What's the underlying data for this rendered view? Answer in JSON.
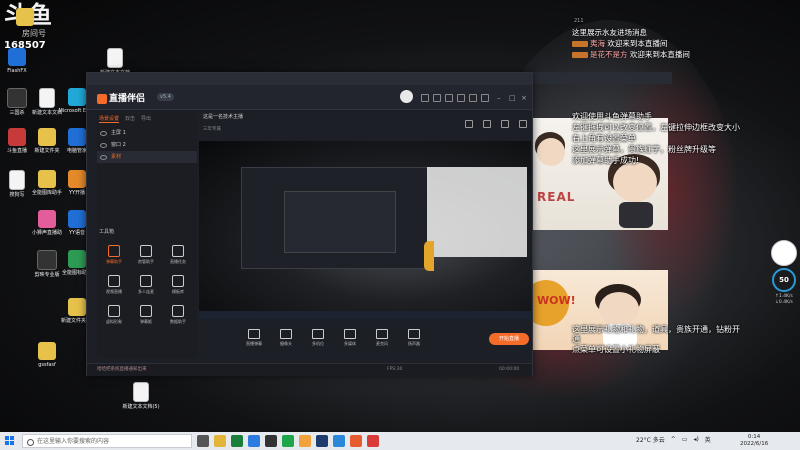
{
  "overlay": {
    "logo": "斗鱼",
    "room_label": "房间号",
    "room_number": "168507"
  },
  "desktop_icons": [
    {
      "label": "",
      "kind": "folder"
    },
    {
      "label": "新建文本文档",
      "kind": "doc"
    },
    {
      "label": "FlashFX",
      "kind": "blue"
    },
    {
      "label": "三国杀",
      "kind": "dark"
    },
    {
      "label": "新建文本文档",
      "kind": "doc"
    },
    {
      "label": "Microsoft Edge",
      "kind": "cyan"
    },
    {
      "label": "斗鱼直播",
      "kind": "red"
    },
    {
      "label": "新建文件夹",
      "kind": "folder"
    },
    {
      "label": "电脑管家",
      "kind": "blue"
    },
    {
      "label": "双环斗地主",
      "kind": "red"
    },
    {
      "label": "微信图片_2022022...",
      "kind": "doc"
    },
    {
      "label": "YY开播",
      "kind": "dark"
    },
    {
      "label": "搜狗写",
      "kind": "blue"
    },
    {
      "label": "全能图库助手",
      "kind": "folder"
    },
    {
      "label": "YY开播",
      "kind": "orange"
    },
    {
      "label": "小狮声直播助",
      "kind": "pink"
    },
    {
      "label": "YY语音",
      "kind": "blue"
    },
    {
      "label": "剪映专业版",
      "kind": "dark"
    },
    {
      "label": "全能图标助手",
      "kind": "green"
    },
    {
      "label": "新建文件夹(2)",
      "kind": "folder"
    },
    {
      "label": "gssfasf",
      "kind": "folder"
    },
    {
      "label": "新建文本文档(5)",
      "kind": "doc"
    }
  ],
  "app": {
    "name": "直播伴侣",
    "version": "v5.4",
    "tabs": [
      "场景设置",
      "双击",
      "导出"
    ],
    "scenes": [
      {
        "label": "主屏 1"
      },
      {
        "label": "窗口 2"
      },
      {
        "label": "素材"
      }
    ],
    "tools_title": "工具箱",
    "tools": [
      {
        "label": "弹幕助手"
      },
      {
        "label": "房管助手"
      },
      {
        "label": "直播任务"
      },
      {
        "label": "视频直播"
      },
      {
        "label": "多人连麦"
      },
      {
        "label": "模板库"
      },
      {
        "label": "虚拟形象"
      },
      {
        "label": "弹幕姬"
      },
      {
        "label": "数据助手"
      }
    ],
    "preview_title": "这是一名技术主播",
    "preview_sub": "三年专属",
    "preview_viewers": "211",
    "bottom_buttons": [
      "直播弹幕",
      "摄像头",
      "多机位",
      "多媒体",
      "麦克风",
      "扬声器"
    ],
    "start_live": "开始直播",
    "status_warning": "哈哈把系统直播通知出来",
    "status_items": [
      "FPS:30",
      "00:00:00"
    ]
  },
  "danmaku": {
    "viewer_count": "211",
    "lines": [
      {
        "text": "这里展示水友进场消息",
        "name": "",
        "content": ""
      },
      {
        "text": "",
        "name": "夷海",
        "content": "欢迎来到本直播间"
      },
      {
        "text": "",
        "name": "是花不是方",
        "content": "欢迎来到本直播间"
      }
    ],
    "help_lines": [
      "欢迎使用斗鱼弹幕助手",
      "左键拖拽可以改变位置，左键拉伸边框改变大小",
      "右上角有设置菜单",
      "这里展示弹幕，贵族红字，粉丝牌升级等",
      "添加弹幕助手成功!"
    ],
    "gift_lines": [
      "这里展示礼物和礼物，道具，贵族开通，钻粉开通",
      "点菜单可设置小礼物屏蔽"
    ]
  },
  "wow_badge": "WOW!",
  "real_label": "REAL",
  "side_widget": {
    "percent": "50",
    "up": "↑1.4K/s",
    "down": "↓0.4K/s"
  },
  "taskbar": {
    "search_placeholder": "在这里输入你要搜索的内容",
    "weather": "22°C 多云",
    "time": "0:14",
    "date": "2022/6/16",
    "lang": "英"
  },
  "colors": {
    "accent": "#f46b2a",
    "taskbar": "#e6e9ee"
  }
}
